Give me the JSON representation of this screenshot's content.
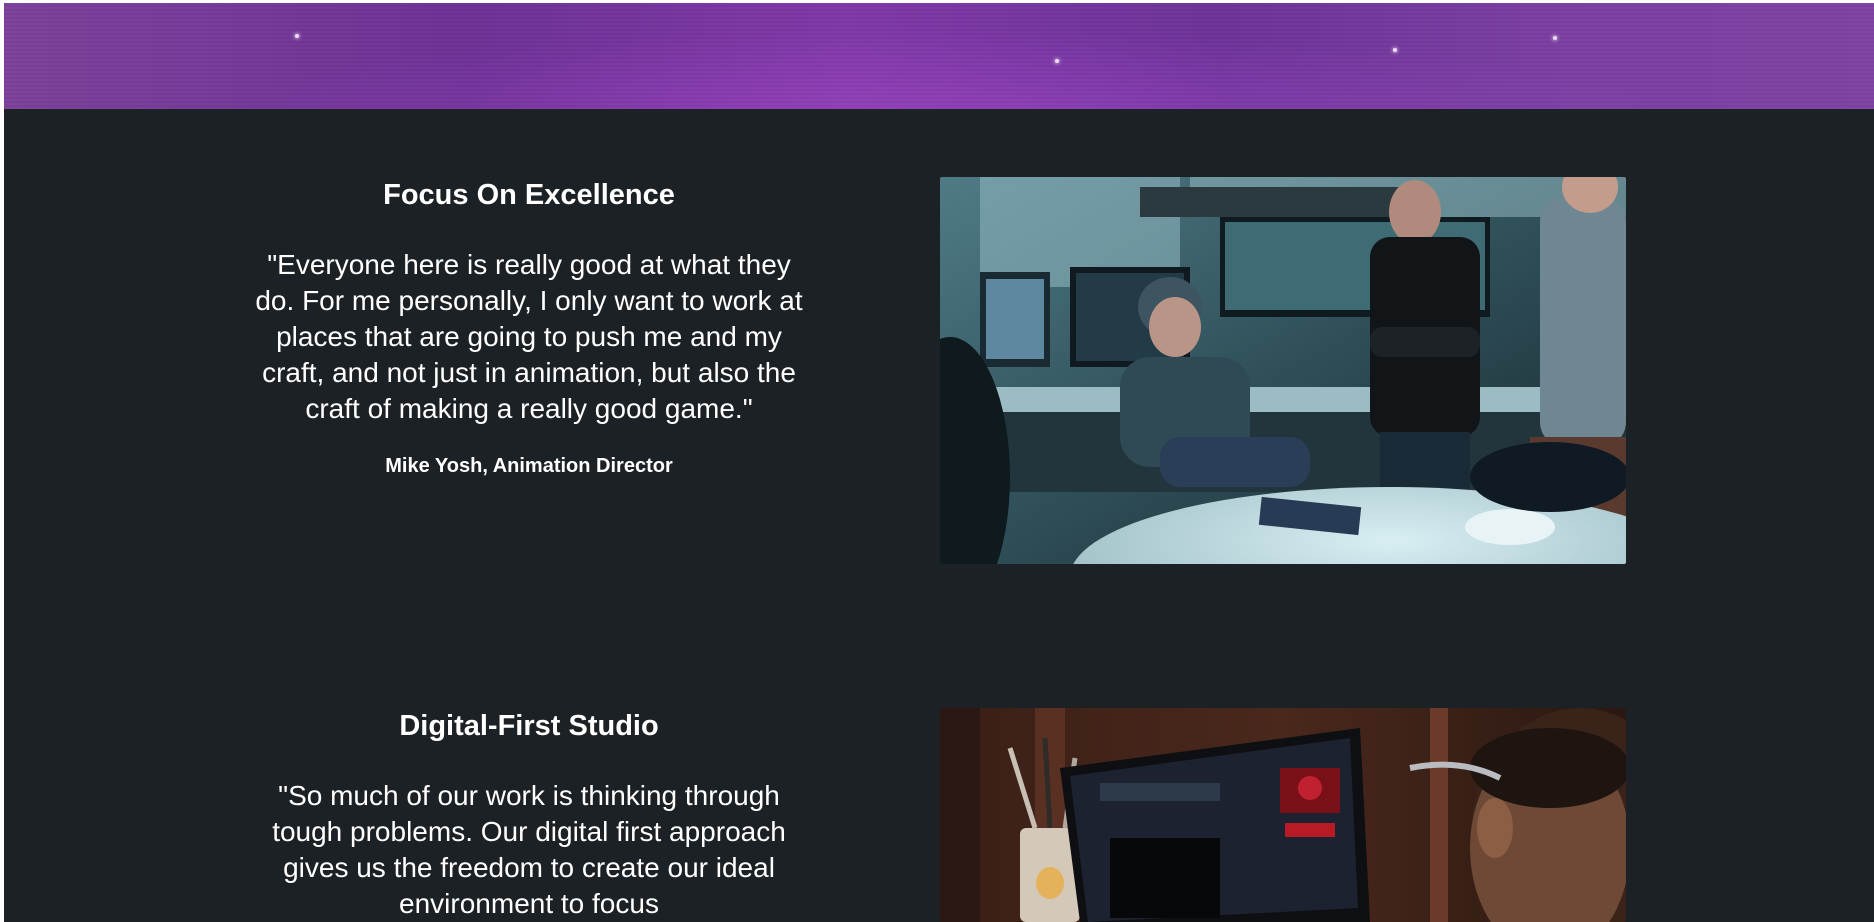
{
  "sections": [
    {
      "heading": "Focus On Excellence",
      "quote": "\"Everyone here is really good at what they do. For me personally, I only want to work at places that are going to push me and my craft, and not just in animation, but also the craft of making a really good game.\"",
      "author": "Mike Yosh, Animation Director",
      "image": "team-meeting-photo"
    },
    {
      "heading": "Digital-First Studio",
      "quote": "\"So much of our work is thinking through tough problems. Our digital first approach gives us the freedom to create our ideal environment to focus",
      "author": "",
      "image": "laptop-workspace-photo"
    }
  ],
  "colors": {
    "page_background": "#1c2125",
    "banner_purple": "#7a3ea0",
    "text": "#ffffff"
  }
}
